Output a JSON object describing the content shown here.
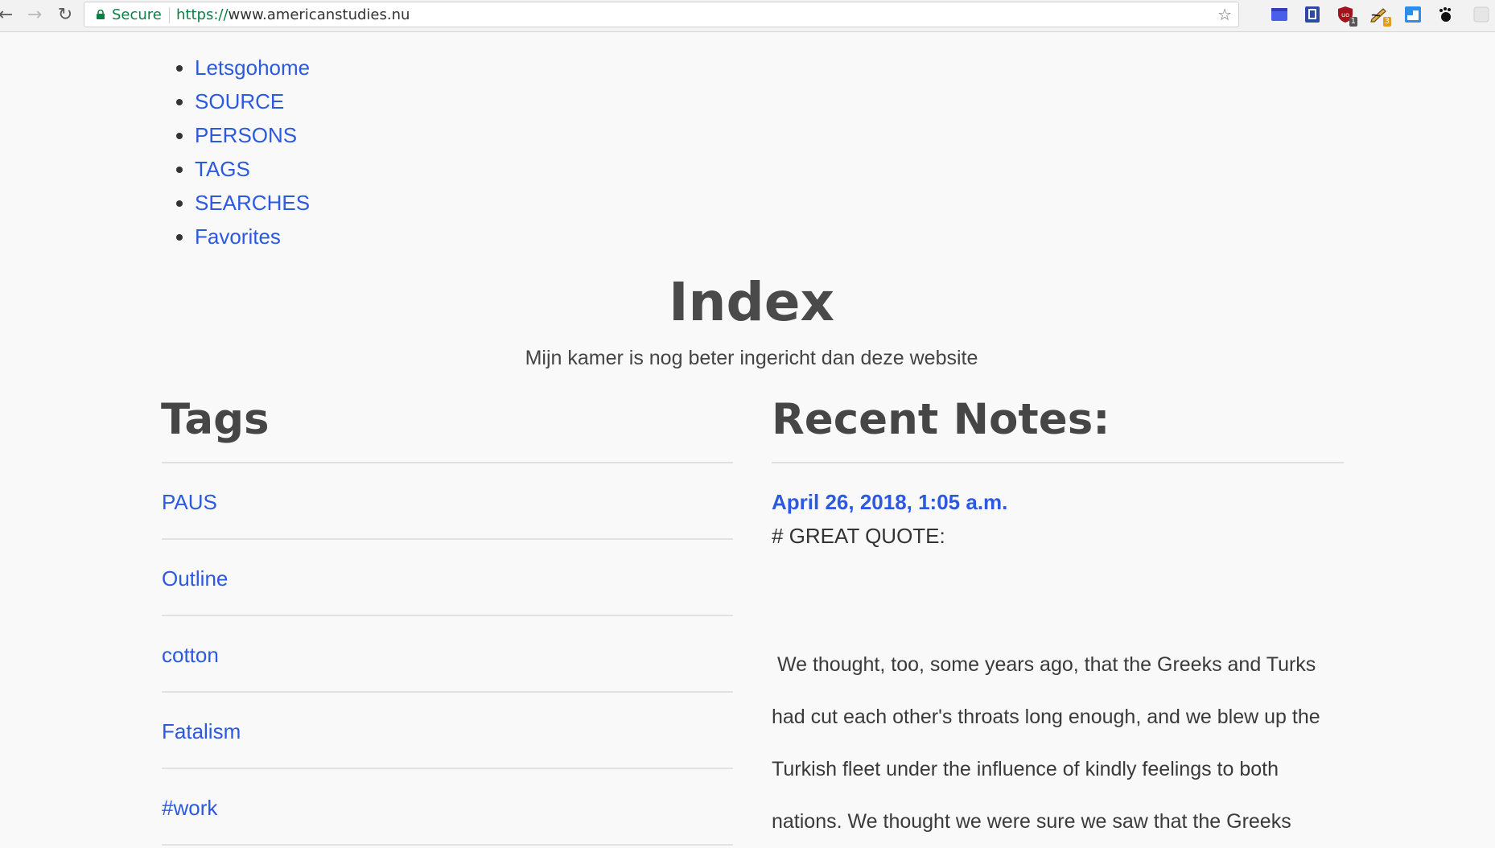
{
  "browser": {
    "secure_label": "Secure",
    "url_scheme": "https://",
    "url_host": "www.americanstudies.nu",
    "extensions": [
      {
        "icon": "blue-square-icon",
        "color": "#4a5fe8",
        "badge": ""
      },
      {
        "icon": "book-icon",
        "color": "#2c4aa3",
        "badge": ""
      },
      {
        "icon": "shield-icon",
        "color": "#a3131b",
        "badge": "1"
      },
      {
        "icon": "pencil-icon",
        "color": "#6d4a1a",
        "badge": "3"
      },
      {
        "icon": "window-icon",
        "color": "#2f8de4",
        "badge": ""
      },
      {
        "icon": "gnome-foot-icon",
        "color": "#111111",
        "badge": ""
      },
      {
        "icon": "puzzle-icon",
        "color": "#cfcfcf",
        "badge": ""
      }
    ]
  },
  "nav": {
    "items": [
      {
        "label": "Letsgohome"
      },
      {
        "label": "SOURCE"
      },
      {
        "label": "PERSONS"
      },
      {
        "label": "TAGS"
      },
      {
        "label": "SEARCHES"
      },
      {
        "label": "Favorites"
      }
    ]
  },
  "page": {
    "title": "Index",
    "subtitle": "Mijn kamer is nog beter ingericht dan deze website"
  },
  "tags": {
    "heading": "Tags",
    "items": [
      {
        "label": "PAUS"
      },
      {
        "label": "Outline"
      },
      {
        "label": "cotton"
      },
      {
        "label": "Fatalism"
      },
      {
        "label": "#work"
      }
    ]
  },
  "notes": {
    "heading": "Recent Notes:",
    "latest": {
      "date": "April 26, 2018, 1:05 a.m.",
      "heading": "# GREAT QUOTE:",
      "body": " We thought, too, some years ago, that the Greeks and Turks\nhad cut each other's throats long enough, and we blew up the\nTurkish fleet under the influence of kindly feelings to both\nnations. We thought we were sure we saw that the Greeks"
    }
  },
  "colors": {
    "link": "#2b59e0",
    "text": "#444444",
    "secure": "#0b8043",
    "background": "#f9f9f9"
  }
}
